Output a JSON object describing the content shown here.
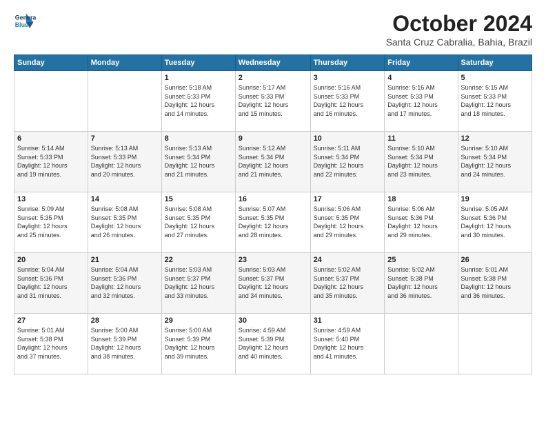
{
  "logo": {
    "line1": "General",
    "line2": "Blue"
  },
  "title": "October 2024",
  "subtitle": "Santa Cruz Cabralia, Bahia, Brazil",
  "days_header": [
    "Sunday",
    "Monday",
    "Tuesday",
    "Wednesday",
    "Thursday",
    "Friday",
    "Saturday"
  ],
  "weeks": [
    [
      {
        "day": "",
        "detail": ""
      },
      {
        "day": "",
        "detail": ""
      },
      {
        "day": "1",
        "detail": "Sunrise: 5:18 AM\nSunset: 5:33 PM\nDaylight: 12 hours\nand 14 minutes."
      },
      {
        "day": "2",
        "detail": "Sunrise: 5:17 AM\nSunset: 5:33 PM\nDaylight: 12 hours\nand 15 minutes."
      },
      {
        "day": "3",
        "detail": "Sunrise: 5:16 AM\nSunset: 5:33 PM\nDaylight: 12 hours\nand 16 minutes."
      },
      {
        "day": "4",
        "detail": "Sunrise: 5:16 AM\nSunset: 5:33 PM\nDaylight: 12 hours\nand 17 minutes."
      },
      {
        "day": "5",
        "detail": "Sunrise: 5:15 AM\nSunset: 5:33 PM\nDaylight: 12 hours\nand 18 minutes."
      }
    ],
    [
      {
        "day": "6",
        "detail": "Sunrise: 5:14 AM\nSunset: 5:33 PM\nDaylight: 12 hours\nand 19 minutes."
      },
      {
        "day": "7",
        "detail": "Sunrise: 5:13 AM\nSunset: 5:33 PM\nDaylight: 12 hours\nand 20 minutes."
      },
      {
        "day": "8",
        "detail": "Sunrise: 5:13 AM\nSunset: 5:34 PM\nDaylight: 12 hours\nand 21 minutes."
      },
      {
        "day": "9",
        "detail": "Sunrise: 5:12 AM\nSunset: 5:34 PM\nDaylight: 12 hours\nand 21 minutes."
      },
      {
        "day": "10",
        "detail": "Sunrise: 5:11 AM\nSunset: 5:34 PM\nDaylight: 12 hours\nand 22 minutes."
      },
      {
        "day": "11",
        "detail": "Sunrise: 5:10 AM\nSunset: 5:34 PM\nDaylight: 12 hours\nand 23 minutes."
      },
      {
        "day": "12",
        "detail": "Sunrise: 5:10 AM\nSunset: 5:34 PM\nDaylight: 12 hours\nand 24 minutes."
      }
    ],
    [
      {
        "day": "13",
        "detail": "Sunrise: 5:09 AM\nSunset: 5:35 PM\nDaylight: 12 hours\nand 25 minutes."
      },
      {
        "day": "14",
        "detail": "Sunrise: 5:08 AM\nSunset: 5:35 PM\nDaylight: 12 hours\nand 26 minutes."
      },
      {
        "day": "15",
        "detail": "Sunrise: 5:08 AM\nSunset: 5:35 PM\nDaylight: 12 hours\nand 27 minutes."
      },
      {
        "day": "16",
        "detail": "Sunrise: 5:07 AM\nSunset: 5:35 PM\nDaylight: 12 hours\nand 28 minutes."
      },
      {
        "day": "17",
        "detail": "Sunrise: 5:06 AM\nSunset: 5:35 PM\nDaylight: 12 hours\nand 29 minutes."
      },
      {
        "day": "18",
        "detail": "Sunrise: 5:06 AM\nSunset: 5:36 PM\nDaylight: 12 hours\nand 29 minutes."
      },
      {
        "day": "19",
        "detail": "Sunrise: 5:05 AM\nSunset: 5:36 PM\nDaylight: 12 hours\nand 30 minutes."
      }
    ],
    [
      {
        "day": "20",
        "detail": "Sunrise: 5:04 AM\nSunset: 5:36 PM\nDaylight: 12 hours\nand 31 minutes."
      },
      {
        "day": "21",
        "detail": "Sunrise: 5:04 AM\nSunset: 5:36 PM\nDaylight: 12 hours\nand 32 minutes."
      },
      {
        "day": "22",
        "detail": "Sunrise: 5:03 AM\nSunset: 5:37 PM\nDaylight: 12 hours\nand 33 minutes."
      },
      {
        "day": "23",
        "detail": "Sunrise: 5:03 AM\nSunset: 5:37 PM\nDaylight: 12 hours\nand 34 minutes."
      },
      {
        "day": "24",
        "detail": "Sunrise: 5:02 AM\nSunset: 5:37 PM\nDaylight: 12 hours\nand 35 minutes."
      },
      {
        "day": "25",
        "detail": "Sunrise: 5:02 AM\nSunset: 5:38 PM\nDaylight: 12 hours\nand 36 minutes."
      },
      {
        "day": "26",
        "detail": "Sunrise: 5:01 AM\nSunset: 5:38 PM\nDaylight: 12 hours\nand 36 minutes."
      }
    ],
    [
      {
        "day": "27",
        "detail": "Sunrise: 5:01 AM\nSunset: 5:38 PM\nDaylight: 12 hours\nand 37 minutes."
      },
      {
        "day": "28",
        "detail": "Sunrise: 5:00 AM\nSunset: 5:39 PM\nDaylight: 12 hours\nand 38 minutes."
      },
      {
        "day": "29",
        "detail": "Sunrise: 5:00 AM\nSunset: 5:39 PM\nDaylight: 12 hours\nand 39 minutes."
      },
      {
        "day": "30",
        "detail": "Sunrise: 4:59 AM\nSunset: 5:39 PM\nDaylight: 12 hours\nand 40 minutes."
      },
      {
        "day": "31",
        "detail": "Sunrise: 4:59 AM\nSunset: 5:40 PM\nDaylight: 12 hours\nand 41 minutes."
      },
      {
        "day": "",
        "detail": ""
      },
      {
        "day": "",
        "detail": ""
      }
    ]
  ]
}
